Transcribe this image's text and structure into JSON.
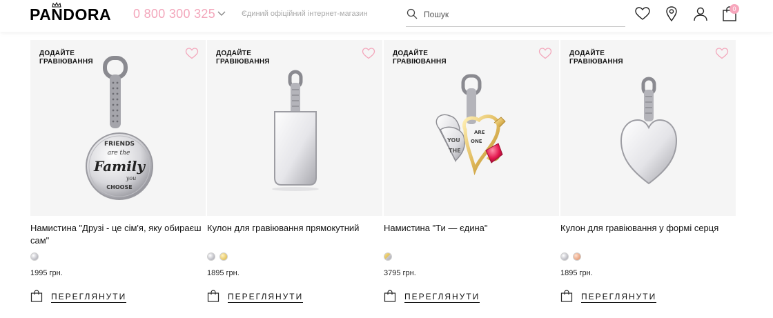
{
  "header": {
    "logo": "PANDORA",
    "phone": "0 800 300 325",
    "tagline": "Єдиний офіційний інтернет-магазин",
    "search_placeholder": "Пошук",
    "cart_count": "0",
    "icons": [
      "heart-icon",
      "location-icon",
      "user-icon",
      "shopping-bag-icon"
    ],
    "accent_color": "#f3a6bb"
  },
  "products": [
    {
      "badge_line1": "ДОДАЙТЕ",
      "badge_line2": "ГРАВІЮВАННЯ",
      "name": "Намистина \"Друзі - це сім'я, яку обираєш сам\"",
      "swatches": [
        "silver"
      ],
      "price": "1995 грн.",
      "action": "ПЕРЕГЛЯНУТИ",
      "image_text": [
        "FRIENDS",
        "are the",
        "Family",
        "you",
        "CHOOSE"
      ]
    },
    {
      "badge_line1": "ДОДАЙТЕ",
      "badge_line2": "ГРАВІЮВАННЯ",
      "name": "Кулон для гравіювання прямокутний",
      "swatches": [
        "silver",
        "gold"
      ],
      "price": "1895 грн.",
      "action": "ПЕРЕГЛЯНУТИ"
    },
    {
      "badge_line1": "ДОДАЙТЕ",
      "badge_line2": "ГРАВІЮВАННЯ",
      "name": "Намистина \"Ти — єдина\"",
      "swatches": [
        "two-tone"
      ],
      "price": "3795 грн.",
      "action": "ПЕРЕГЛЯНУТИ",
      "image_text": [
        "YOU",
        "ARE",
        "THE",
        "ONE"
      ]
    },
    {
      "badge_line1": "ДОДАЙТЕ",
      "badge_line2": "ГРАВІЮВАННЯ",
      "name": "Кулон для гравіювання у формі серця",
      "swatches": [
        "silver",
        "rose-gold"
      ],
      "price": "1895 грн.",
      "action": "ПЕРЕГЛЯНУТИ"
    }
  ]
}
